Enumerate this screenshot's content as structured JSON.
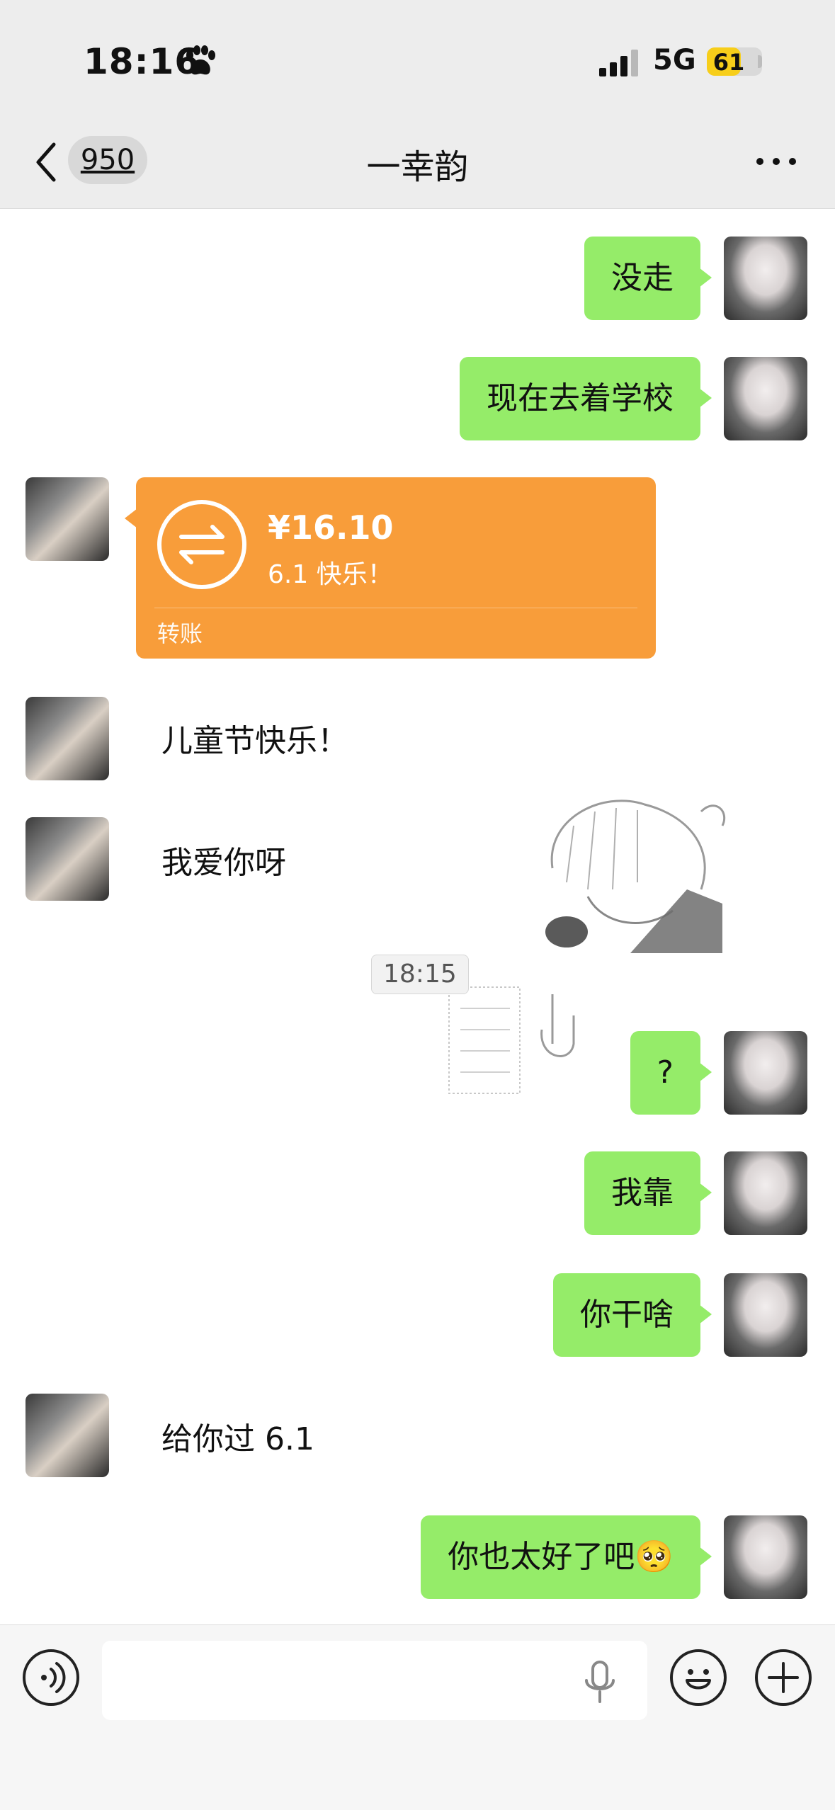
{
  "status_bar": {
    "time": "18:16",
    "network": "5G",
    "battery": "61",
    "battery_level": 0.61
  },
  "nav": {
    "unread_count": "950",
    "title": "一幸韵"
  },
  "messages": [
    {
      "from": "me",
      "text": "没走"
    },
    {
      "from": "me",
      "text": "现在去着学校"
    },
    {
      "from": "other",
      "type": "transfer",
      "amount": "¥16.10",
      "note": "6.1 快乐！",
      "label": "转账"
    },
    {
      "from": "other",
      "text": "儿童节快乐！"
    },
    {
      "from": "other",
      "text": "我爱你呀"
    },
    {
      "type": "time",
      "text": "18:15"
    },
    {
      "from": "me",
      "text": "?"
    },
    {
      "from": "me",
      "text": "我靠"
    },
    {
      "from": "me",
      "text": "你干啥"
    },
    {
      "from": "other",
      "text": "给你过 6.1"
    },
    {
      "from": "me",
      "text": "你也太好了吧🥺"
    }
  ],
  "input": {
    "placeholder": ""
  },
  "icons": {
    "back": "chevron-left-icon",
    "more": "more-icon",
    "voice": "voice-icon",
    "mic": "microphone-icon",
    "emoji": "emoji-icon",
    "add": "plus-icon"
  },
  "colors": {
    "nav_bg": "#ededed",
    "my_bubble": "#95ec69",
    "transfer_card": "#f89d3a",
    "battery_fill": "#f7ce1a"
  }
}
